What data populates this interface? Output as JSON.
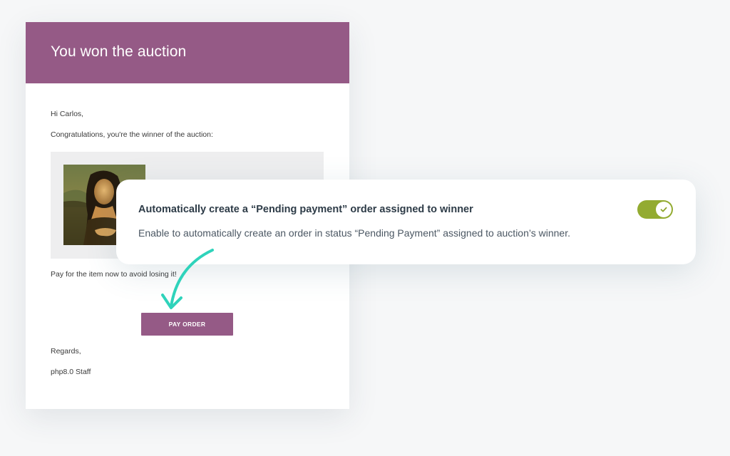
{
  "email": {
    "title": "You won the auction",
    "greeting": "Hi Carlos,",
    "intro": "Congratulations, you're the winner of the auction:",
    "pay_prompt": "Pay for the item now to avoid losing it!",
    "pay_button_label": "PAY ORDER",
    "regards": "Regards,",
    "signature": "php8.0 Staff"
  },
  "feature": {
    "title": "Automatically create a “Pending payment” order assigned to winner",
    "description": "Enable to automatically create an order in status “Pending Payment” assigned to auction’s winner.",
    "toggle_state": "on"
  },
  "icons": {
    "check": "check-icon",
    "arrow": "curved-arrow-icon",
    "product_image": "mona-lisa-image"
  },
  "colors": {
    "brand_purple": "#955a86",
    "toggle_green": "#93ab31",
    "arrow_teal": "#2fd3bb"
  }
}
